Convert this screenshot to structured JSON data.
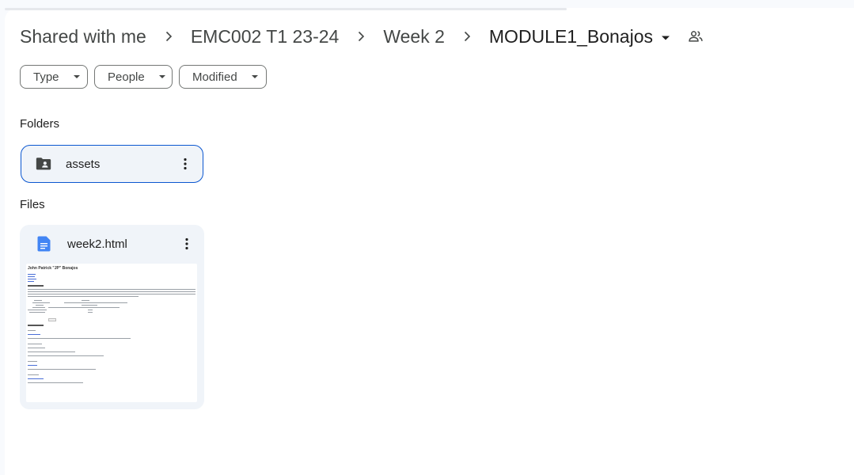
{
  "breadcrumb": {
    "items": [
      {
        "label": "Shared with me"
      },
      {
        "label": "EMC002 T1 23-24"
      },
      {
        "label": "Week 2"
      }
    ],
    "current": "MODULE1_Bonajos"
  },
  "filters": {
    "type": "Type",
    "people": "People",
    "modified": "Modified"
  },
  "sections": {
    "folders": "Folders",
    "files": "Files"
  },
  "folders": [
    {
      "name": "assets",
      "icon": "shared-folder-icon"
    }
  ],
  "files": [
    {
      "name": "week2.html",
      "icon": "docs-file-icon",
      "preview_title": "John Patrick \"JP\" Bonajos"
    }
  ],
  "colors": {
    "selected_border": "#0b57d0",
    "card_bg": "#f0f4f9",
    "doc_blue": "#4285f4"
  }
}
